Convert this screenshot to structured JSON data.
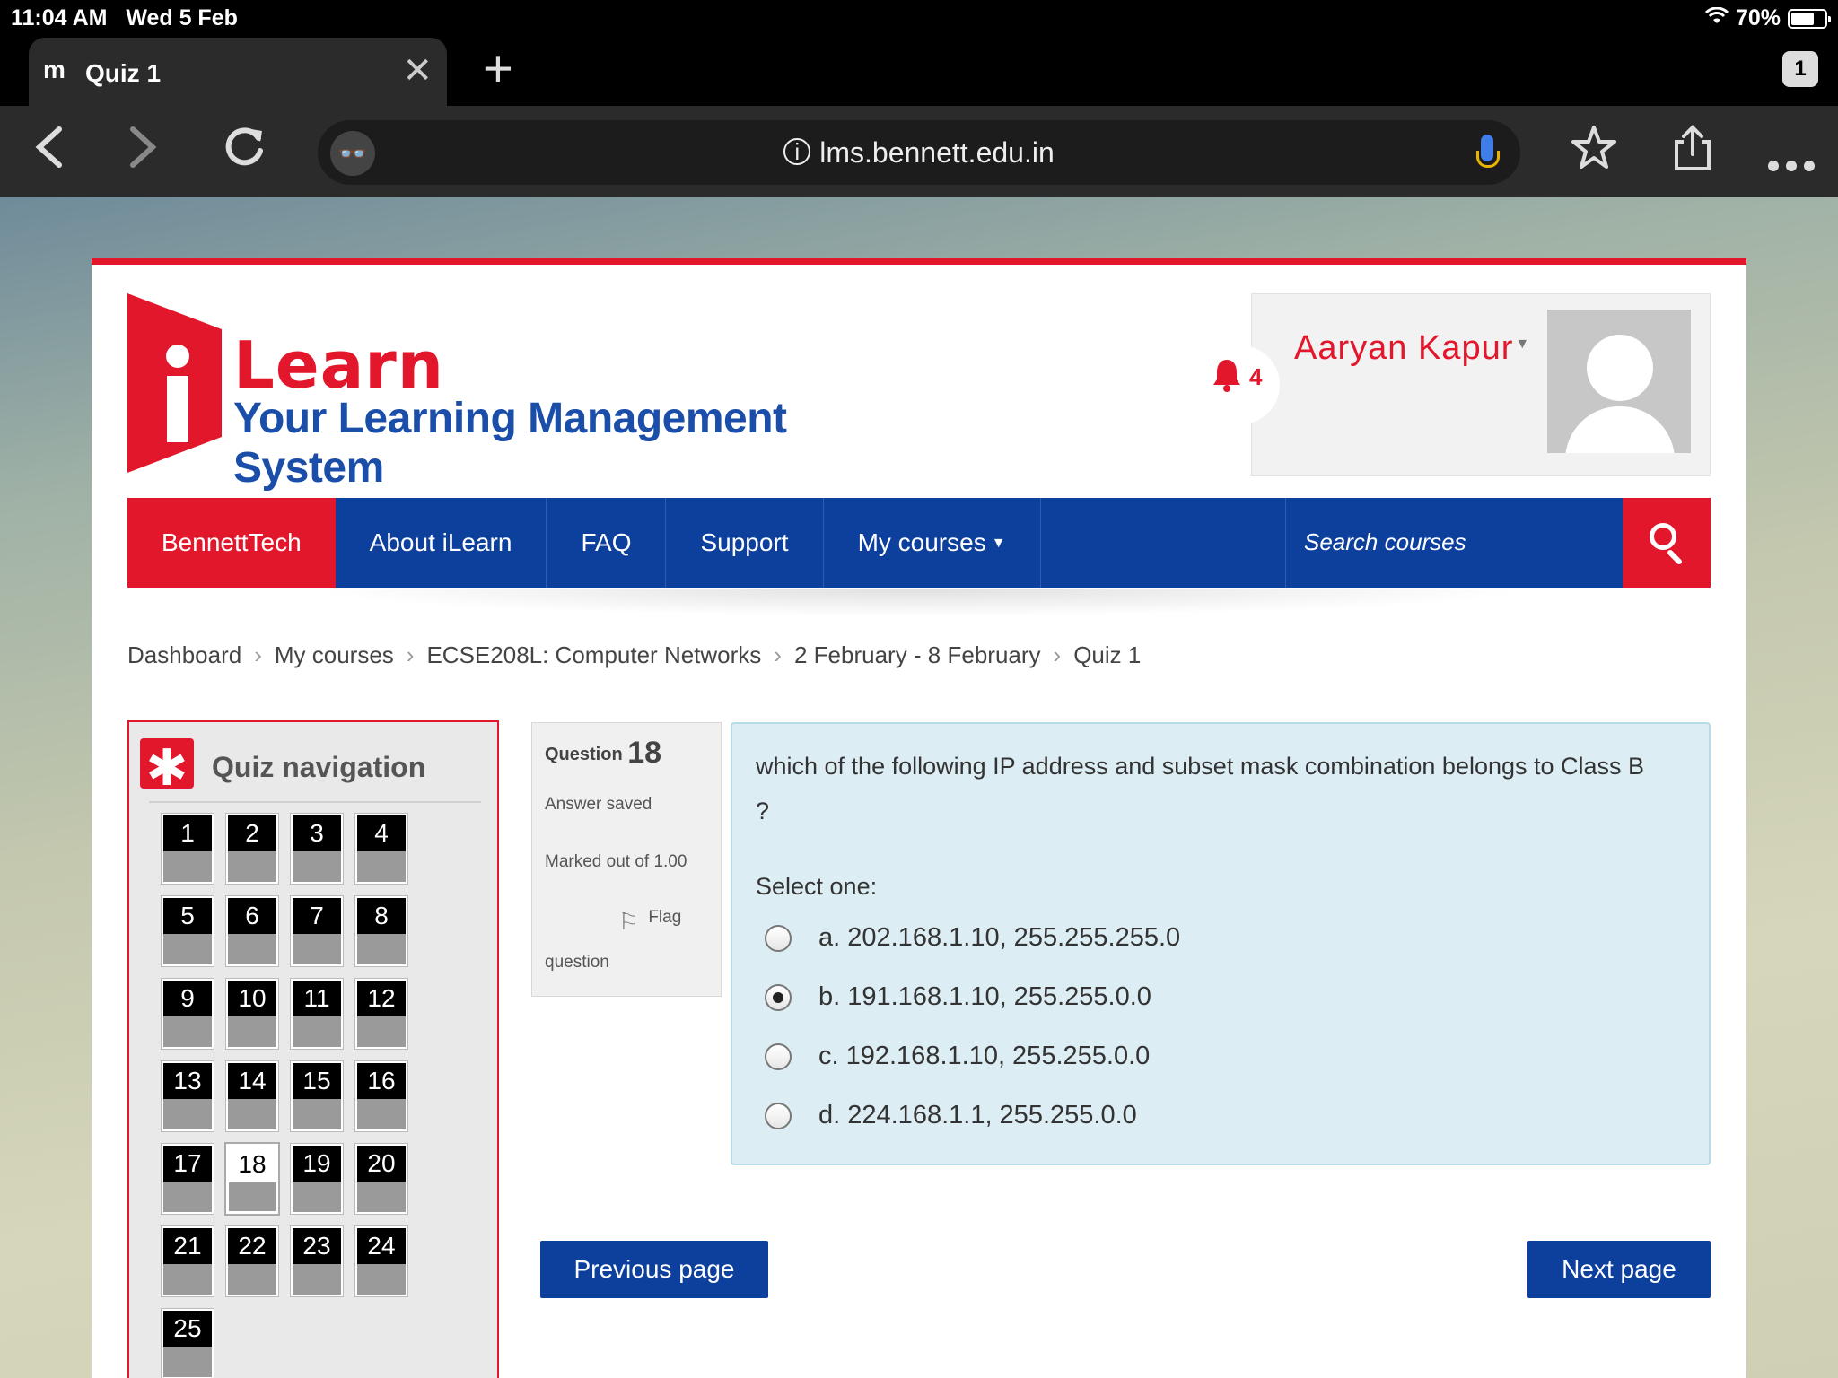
{
  "status_bar": {
    "time": "11:04 AM",
    "date": "Wed 5 Feb",
    "battery": "70%"
  },
  "browser": {
    "tab_title": "Quiz 1",
    "favicon": "m",
    "tab_count": "1",
    "url": "lms.bennett.edu.in"
  },
  "header": {
    "logo_learn": "Learn",
    "logo_tagline": "Your Learning Management System",
    "notification_count": "4",
    "user_name": "Aaryan Kapur"
  },
  "nav": {
    "items": [
      "BennettTech",
      "About iLearn",
      "FAQ",
      "Support",
      "My courses"
    ],
    "search_placeholder": "Search courses"
  },
  "breadcrumb": [
    "Dashboard",
    "My courses",
    "ECSE208L: Computer Networks",
    "2 February - 8 February",
    "Quiz 1"
  ],
  "quiz_nav": {
    "title": "Quiz navigation",
    "questions": [
      "1",
      "2",
      "3",
      "4",
      "5",
      "6",
      "7",
      "8",
      "9",
      "10",
      "11",
      "12",
      "13",
      "14",
      "15",
      "16",
      "17",
      "18",
      "19",
      "20",
      "21",
      "22",
      "23",
      "24",
      "25"
    ],
    "current": "18"
  },
  "question": {
    "label": "Question",
    "number": "18",
    "state": "Answer saved",
    "grade": "Marked out of 1.00",
    "flag_label": "Flag",
    "flag_label_2": "question",
    "text": "which of the following IP address and subset mask combination belongs to Class B ?",
    "prompt": "Select one:",
    "options": [
      {
        "label": "a. 202.168.1.10, 255.255.255.0",
        "selected": false
      },
      {
        "label": "b. 191.168.1.10, 255.255.0.0",
        "selected": true
      },
      {
        "label": "c. 192.168.1.10, 255.255.0.0",
        "selected": false
      },
      {
        "label": "d. 224.168.1.1, 255.255.0.0",
        "selected": false
      }
    ]
  },
  "buttons": {
    "previous": "Previous page",
    "next": "Next page"
  }
}
